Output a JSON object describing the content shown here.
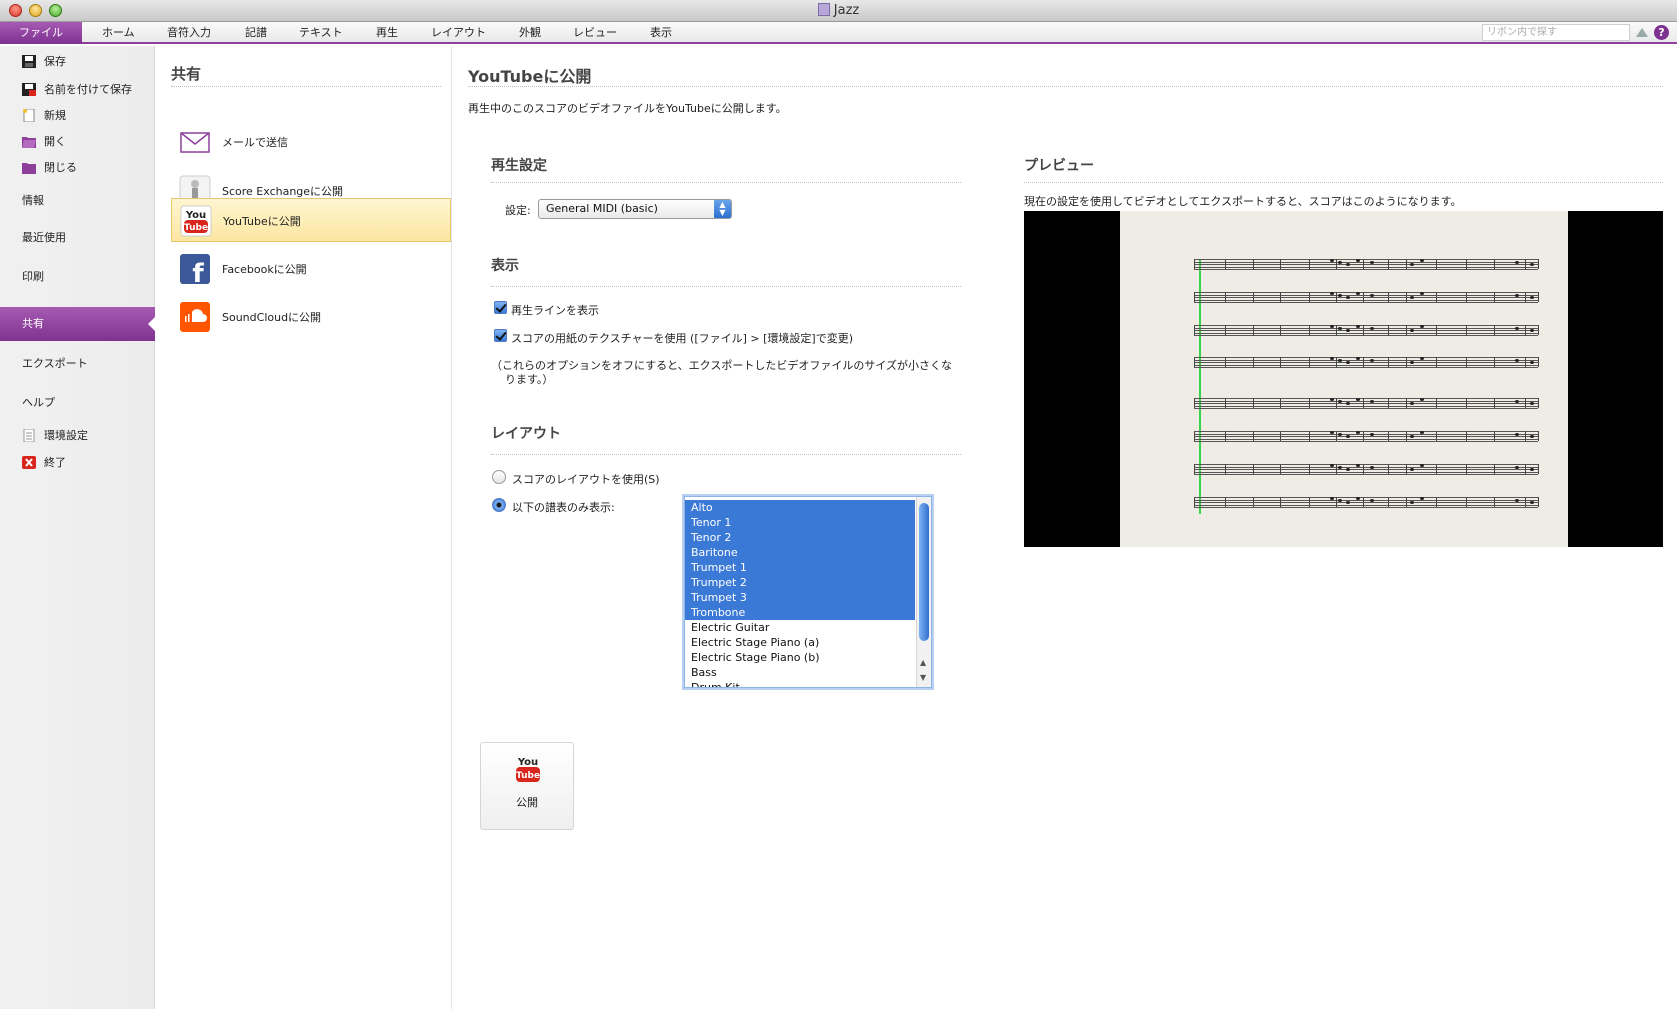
{
  "window": {
    "title": "Jazz"
  },
  "ribbon": {
    "tabs": [
      "ファイル",
      "ホーム",
      "音符入力",
      "記譜",
      "テキスト",
      "再生",
      "レイアウト",
      "外観",
      "レビュー",
      "表示"
    ],
    "search_placeholder": "リボン内で探す",
    "help_label": "?"
  },
  "leftnav": {
    "save": "保存",
    "save_as": "名前を付けて保存",
    "new": "新規",
    "open": "開く",
    "close": "閉じる",
    "info": "情報",
    "recent": "最近使用",
    "print": "印刷",
    "share": "共有",
    "export": "エクスポート",
    "help": "ヘルプ",
    "preferences": "環境設定",
    "quit": "終了"
  },
  "share": {
    "title": "共有",
    "items": [
      "メールで送信",
      "Score Exchangeに公開",
      "YouTubeに公開",
      "Facebookに公開",
      "SoundCloudに公開"
    ]
  },
  "main": {
    "title": "YouTubeに公開",
    "description": "再生中のこのスコアのビデオファイルをYouTubeに公開します。",
    "playback": {
      "title": "再生設定",
      "setting_label": "設定:",
      "setting_value": "General MIDI (basic)"
    },
    "display": {
      "title": "表示",
      "show_playline": "再生ラインを表示",
      "use_paper": "スコアの用紙のテクスチャーを使用 ([ファイル] > [環境設定]で変更)",
      "note_line1": "（これらのオプションをオフにすると、エクスポートしたビデオファイルのサイズが小さくな",
      "note_line2": "ります。）"
    },
    "layout": {
      "title": "レイアウト",
      "use_score_layout": "スコアのレイアウトを使用(S)",
      "show_only": "以下の譜表のみ表示:",
      "staves": [
        {
          "name": "Alto",
          "selected": true
        },
        {
          "name": "Tenor 1",
          "selected": true
        },
        {
          "name": "Tenor 2",
          "selected": true
        },
        {
          "name": "Baritone",
          "selected": true
        },
        {
          "name": "Trumpet 1",
          "selected": true
        },
        {
          "name": "Trumpet 2",
          "selected": true
        },
        {
          "name": "Trumpet 3",
          "selected": true
        },
        {
          "name": "Trombone",
          "selected": true
        },
        {
          "name": "Electric Guitar",
          "selected": false
        },
        {
          "name": "Electric Stage Piano (a)",
          "selected": false
        },
        {
          "name": "Electric Stage Piano (b)",
          "selected": false
        },
        {
          "name": "Bass",
          "selected": false
        },
        {
          "name": "Drum Kit",
          "selected": false
        }
      ]
    },
    "preview": {
      "title": "プレビュー",
      "description": "現在の設定を使用してビデオとしてエクスポートすると、スコアはこのようになります。"
    },
    "publish_label": "公開"
  },
  "colors": {
    "accent_purple": "#8d3f9b",
    "selection_blue": "#3a79d6",
    "youtube_red": "#d9261c",
    "facebook_blue": "#3b5998",
    "soundcloud_orange": "#ff5500"
  }
}
